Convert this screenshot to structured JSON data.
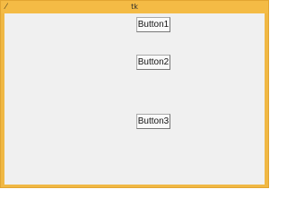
{
  "window": {
    "title": "tk",
    "icon": "feather-icon"
  },
  "buttons": [
    {
      "label": "Button1"
    },
    {
      "label": "Button2"
    },
    {
      "label": "Button3"
    }
  ]
}
